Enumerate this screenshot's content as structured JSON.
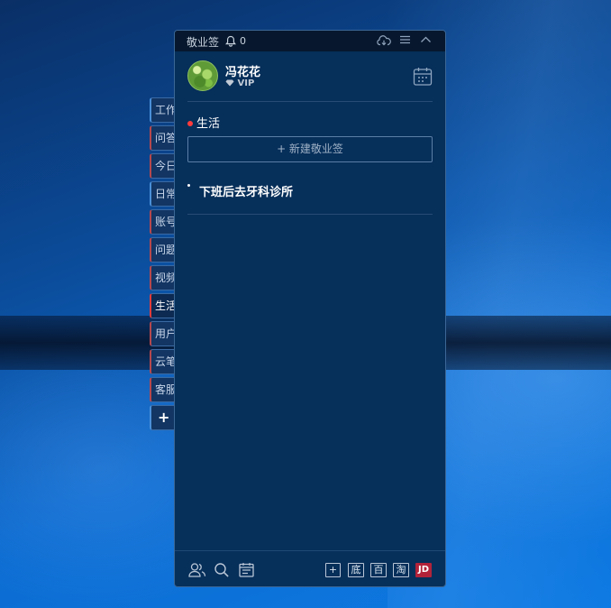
{
  "app": {
    "title": "敬业签",
    "notification_count": "0"
  },
  "side_tabs": {
    "items": [
      {
        "label": "工作"
      },
      {
        "label": "问答"
      },
      {
        "label": "今日"
      },
      {
        "label": "日常"
      },
      {
        "label": "账号"
      },
      {
        "label": "问题"
      },
      {
        "label": "视频"
      },
      {
        "label": "生活"
      },
      {
        "label": "用户"
      },
      {
        "label": "云笔"
      },
      {
        "label": "客服"
      }
    ],
    "active": "生活",
    "add_label": "+"
  },
  "user": {
    "name": "冯花花",
    "badge": "VIP"
  },
  "category": {
    "name": "生活",
    "dot_color": "#ff3b3b"
  },
  "new_note_button": "+ 新建敬业签",
  "notes": [
    {
      "text": "下班后去牙科诊所"
    }
  ],
  "footer": {
    "icons": [
      "contacts-icon",
      "search-icon",
      "calendar-list-icon"
    ],
    "shortcuts": [
      {
        "label": "+"
      },
      {
        "label": "底"
      },
      {
        "label": "百"
      },
      {
        "label": "淘"
      },
      {
        "label": "JD"
      }
    ]
  },
  "colors": {
    "window_bg": "#062f5a",
    "titlebar_bg": "#07182e",
    "accent_red": "#e23c3c",
    "jd_red": "#b2233a"
  }
}
